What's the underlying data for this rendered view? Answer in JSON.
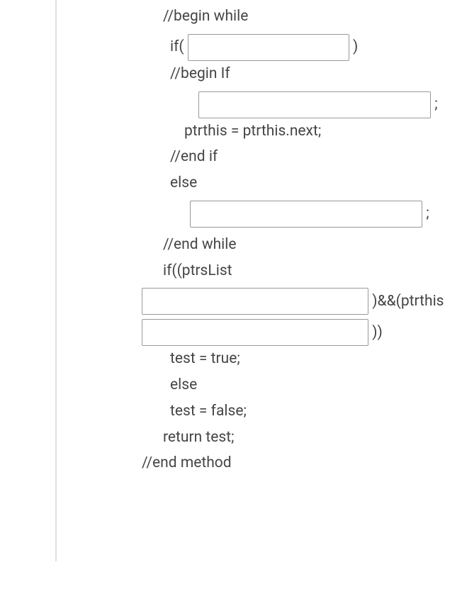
{
  "lines": {
    "beginWhile": "//begin while",
    "ifOpen": "if( ",
    "ifClose": " )",
    "beginIf": "//begin If",
    "semi": " ;",
    "ptrAssign": "ptrthis = ptrthis.next;",
    "endIf": "//end if",
    "elseKw": "else",
    "endWhile": "//end while",
    "ifPtrsList": "if((ptrsList",
    "andPtrThis": " )&&(ptrthis",
    "closeParen": " ))",
    "testTrue": "test = true;",
    "testFalse": "test = false;",
    "returnTest": "return test;",
    "endMethod": "//end method"
  }
}
